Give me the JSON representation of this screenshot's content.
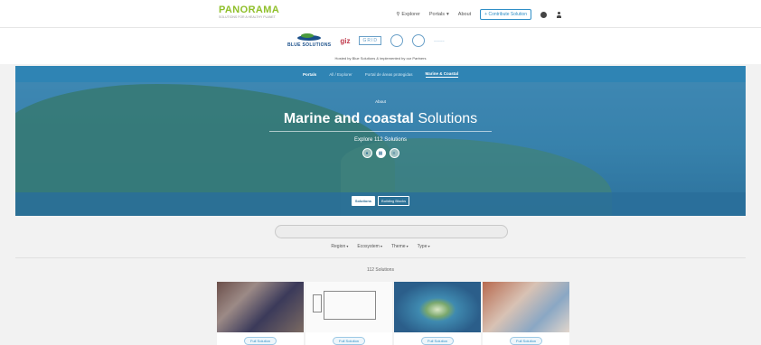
{
  "brand": {
    "name": "PANORAMA",
    "tagline": "SOLUTIONS FOR A HEALTHY PLANET"
  },
  "nav": {
    "explorer": "Explorer",
    "portals": "Portals",
    "about": "About",
    "contribute": "Contribute Solution"
  },
  "partners": {
    "blue_solutions": "BLUE SOLUTIONS",
    "giz": "giz",
    "grid": "GRID",
    "hosted_by": "Hosted by Blue Solutions & implemented by our Partners"
  },
  "portal_bar": {
    "label": "Portals",
    "items": [
      "All / Explorer",
      "Portal de áreas protegidas",
      "Marine & Coastal"
    ],
    "active_index": 2
  },
  "hero": {
    "about": "About",
    "title_bold": "Marine and coastal",
    "title_light": "Solutions",
    "explore": "Explore 112 Solutions",
    "tabs": [
      "Solutions",
      "Building Blocks"
    ],
    "active_tab": 0
  },
  "filters": [
    "Region",
    "Ecosystem",
    "Theme",
    "Type"
  ],
  "results": {
    "count_label": "112 Solutions"
  },
  "cards": [
    {
      "button": "Full Solution"
    },
    {
      "button": "Full Solution"
    },
    {
      "button": "Full Solution"
    },
    {
      "button": "Full Solution"
    }
  ]
}
